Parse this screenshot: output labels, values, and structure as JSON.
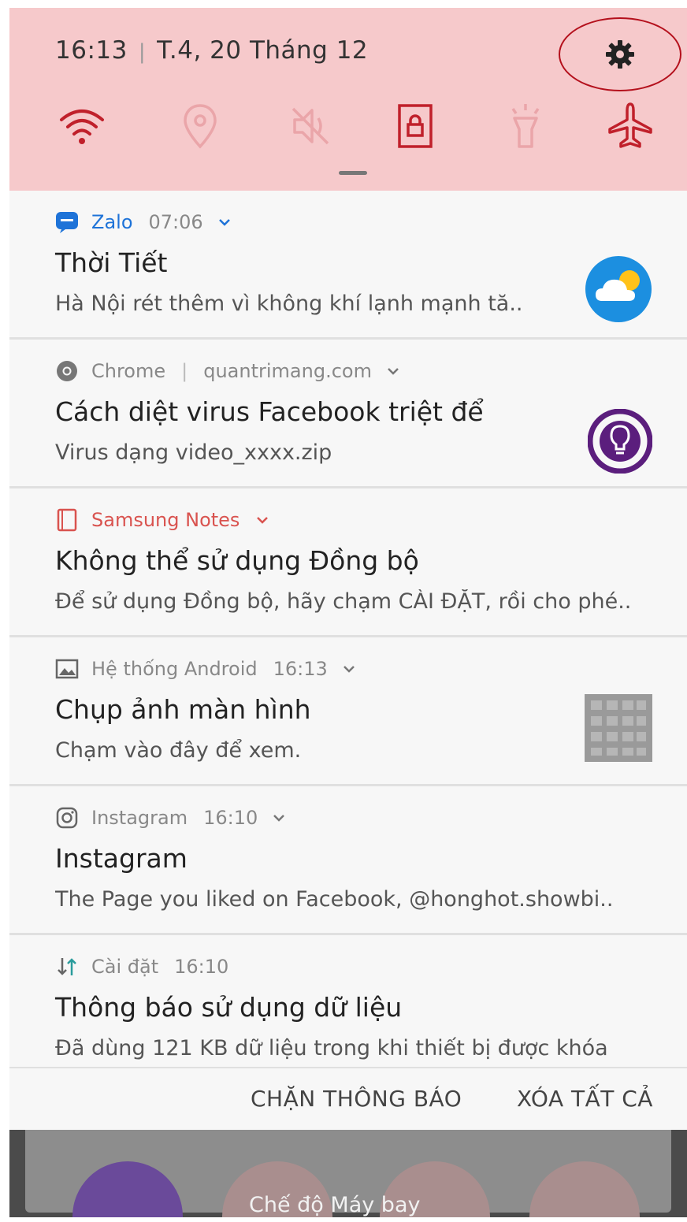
{
  "status": {
    "time": "16:13",
    "date": "T.4, 20 Tháng 12"
  },
  "quick_settings": [
    {
      "name": "wifi",
      "icon": "wifi-icon",
      "active": true
    },
    {
      "name": "location",
      "icon": "location-icon",
      "active": false
    },
    {
      "name": "sound",
      "icon": "mute-icon",
      "active": false
    },
    {
      "name": "rotation_lock",
      "icon": "lock-icon",
      "active": true
    },
    {
      "name": "flashlight",
      "icon": "flashlight-icon",
      "active": false
    },
    {
      "name": "airplane",
      "icon": "airplane-icon",
      "active": true
    }
  ],
  "notifications": [
    {
      "app": "Zalo",
      "time": "07:06",
      "title": "Thời Tiết",
      "text": "Hà Nội rét thêm vì không khí lạnh mạnh tă..",
      "app_color": "#1e73d8",
      "thumb": "weather-icon"
    },
    {
      "app": "Chrome",
      "sep": "|",
      "time": "quantrimang.com",
      "title": "Cách diệt virus Facebook triệt để",
      "text": "Virus dạng video_xxxx.zip",
      "app_color": "#888888",
      "thumb": "bulb-logo-icon"
    },
    {
      "app": "Samsung Notes",
      "time": "",
      "title": "Không thể sử dụng Đồng bộ",
      "text": "Để sử dụng Đồng bộ, hãy chạm CÀI ĐẶT, rồi cho phé..",
      "app_color": "#d9534f",
      "thumb": ""
    },
    {
      "app": "Hệ thống Android",
      "time": "16:13",
      "title": "Chụp ảnh màn hình",
      "text": "Chạm vào đây để xem.",
      "app_color": "#888888",
      "thumb": "screenshot-thumbnail"
    },
    {
      "app": "Instagram",
      "time": "16:10",
      "title": "Instagram",
      "text": "The Page you liked on Facebook, @honghot.showbi..",
      "app_color": "#888888",
      "thumb": ""
    },
    {
      "app": "Cài đặt",
      "time": "16:10",
      "title": "Thông báo sử dụng dữ liệu",
      "text": "Đã dùng 121 KB dữ liệu trong khi thiết bị được khóa",
      "app_color": "#888888",
      "thumb": ""
    }
  ],
  "actions": {
    "block": "CHẶN THÔNG BÁO",
    "clear": "XÓA TẤT CẢ"
  },
  "toast": "Chế độ Máy bay",
  "colors": {
    "accent_red": "#c0202b",
    "quick_panel_bg": "#f6c9cb"
  }
}
